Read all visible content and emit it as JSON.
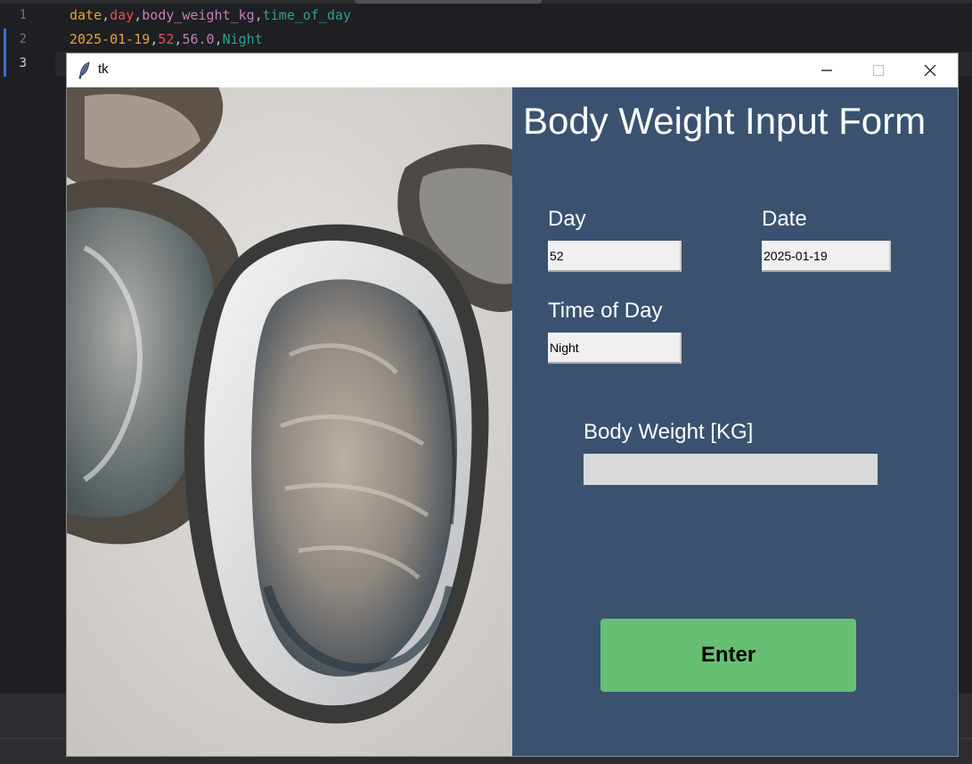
{
  "editor": {
    "line_numbers": [
      "1",
      "2",
      "3"
    ],
    "line1": {
      "t1": "date",
      "c1": ",",
      "t2": "day",
      "c2": ",",
      "t3": "body_weight_kg",
      "c3": ",",
      "t4": "time_of_day"
    },
    "line2": {
      "t1": "2025-01-19",
      "c1": ",",
      "t2": "52",
      "c2": ",",
      "t3": "56.0",
      "c3": ",",
      "t4": "Night"
    }
  },
  "window": {
    "title": "tk",
    "icons": [
      "tk-feather-icon",
      "minimize-icon",
      "maximize-icon",
      "close-icon"
    ]
  },
  "form": {
    "title": "Body Weight Input Form",
    "day_label": "Day",
    "day_value": "52",
    "date_label": "Date",
    "date_value": "2025-01-19",
    "time_label": "Time of Day",
    "time_value": "Night",
    "weight_label": "Body Weight [KG]",
    "weight_value": "",
    "enter_label": "Enter"
  },
  "colors": {
    "form_background": "#3a5270",
    "enter_button": "#67bf74",
    "editor_background": "#1e1f22"
  }
}
